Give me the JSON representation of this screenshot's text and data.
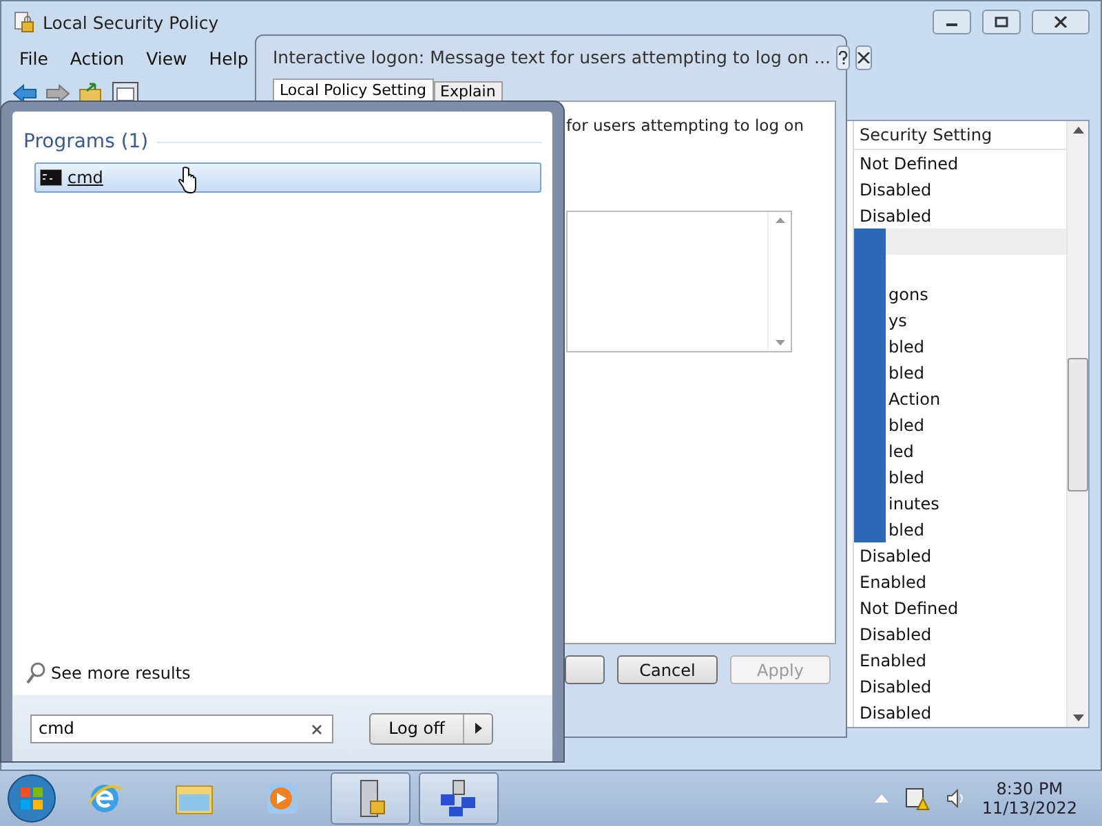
{
  "main_window": {
    "title": "Local Security Policy",
    "menu": [
      "File",
      "Action",
      "View",
      "Help"
    ],
    "list": {
      "column": "Security Setting",
      "rows": [
        {
          "kind": "plain",
          "text": "Not Defined",
          "selected": false
        },
        {
          "kind": "plain",
          "text": "Disabled",
          "selected": false
        },
        {
          "kind": "plain",
          "text": "Disabled",
          "selected": false
        },
        {
          "kind": "clipped",
          "selected": true
        },
        {
          "kind": "clipped",
          "selected": false
        },
        {
          "kind": "clipped",
          "text": "gons",
          "selected": false
        },
        {
          "kind": "clipped",
          "text": "ys",
          "selected": false
        },
        {
          "kind": "clipped",
          "text": "bled",
          "selected": false
        },
        {
          "kind": "clipped",
          "text": "bled",
          "selected": false
        },
        {
          "kind": "clipped",
          "text": "Action",
          "selected": false
        },
        {
          "kind": "clipped",
          "text": "bled",
          "selected": false
        },
        {
          "kind": "clipped",
          "text": "led",
          "selected": false
        },
        {
          "kind": "clipped",
          "text": "bled",
          "selected": false
        },
        {
          "kind": "clipped",
          "text": "inutes",
          "selected": false
        },
        {
          "kind": "clipped",
          "text": "bled",
          "selected": false
        },
        {
          "kind": "plain",
          "text": "Disabled",
          "selected": false
        },
        {
          "kind": "plain",
          "text": "Enabled",
          "selected": false
        },
        {
          "kind": "plain",
          "text": "Not Defined",
          "selected": false
        },
        {
          "kind": "plain",
          "text": "Disabled",
          "selected": false
        },
        {
          "kind": "plain",
          "text": "Enabled",
          "selected": false
        },
        {
          "kind": "plain",
          "text": "Disabled",
          "selected": false
        },
        {
          "kind": "plain",
          "text": "Disabled",
          "selected": false
        }
      ]
    }
  },
  "dialog": {
    "title": "Interactive logon: Message text for users attempting to log on ...",
    "tabs": [
      {
        "label": "Local Policy Setting",
        "selected": true
      },
      {
        "label": "Explain",
        "selected": false
      }
    ],
    "description": "for users attempting to log on",
    "buttons": [
      {
        "label": "Cancel",
        "disabled": false
      },
      {
        "label": "Apply",
        "disabled": true
      }
    ]
  },
  "start_menu": {
    "section": "Programs (1)",
    "results": [
      {
        "label": "cmd",
        "selected": true
      }
    ],
    "more": "See more results",
    "search": {
      "value": "cmd"
    },
    "power_button": "Log off"
  },
  "taskbar": {
    "items": [
      {
        "kind": "browser",
        "active": false
      },
      {
        "kind": "folder",
        "active": false
      },
      {
        "kind": "media",
        "active": false
      },
      {
        "kind": "policy",
        "active": true
      },
      {
        "kind": "network",
        "active": true
      }
    ],
    "time": "8:30 PM",
    "date": "11/13/2022"
  }
}
